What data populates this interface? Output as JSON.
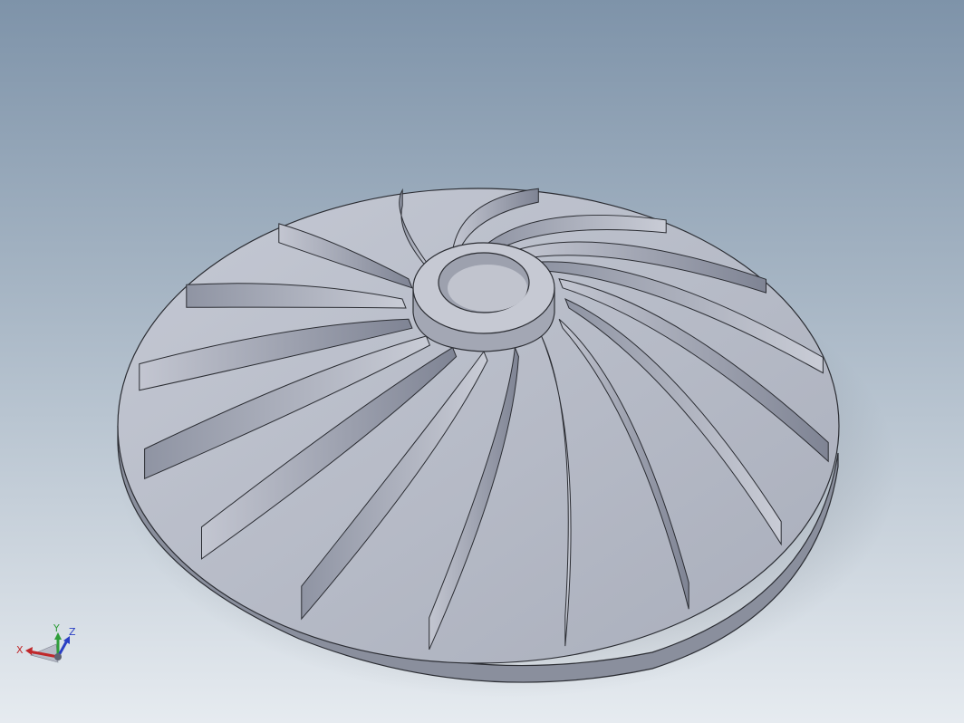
{
  "viewport": {
    "background_top": "#7e93a9",
    "background_bottom": "#e6ebf0",
    "model": {
      "name_hint": "impeller",
      "blade_count": 16,
      "part_color": "#b9bdc9",
      "edge_color": "#2b2d33"
    }
  },
  "triad": {
    "x_label": "X",
    "y_label": "Y",
    "z_label": "Z",
    "x_color": "#c0282b",
    "y_color": "#2f9e3a",
    "z_color": "#2a3fc4"
  }
}
